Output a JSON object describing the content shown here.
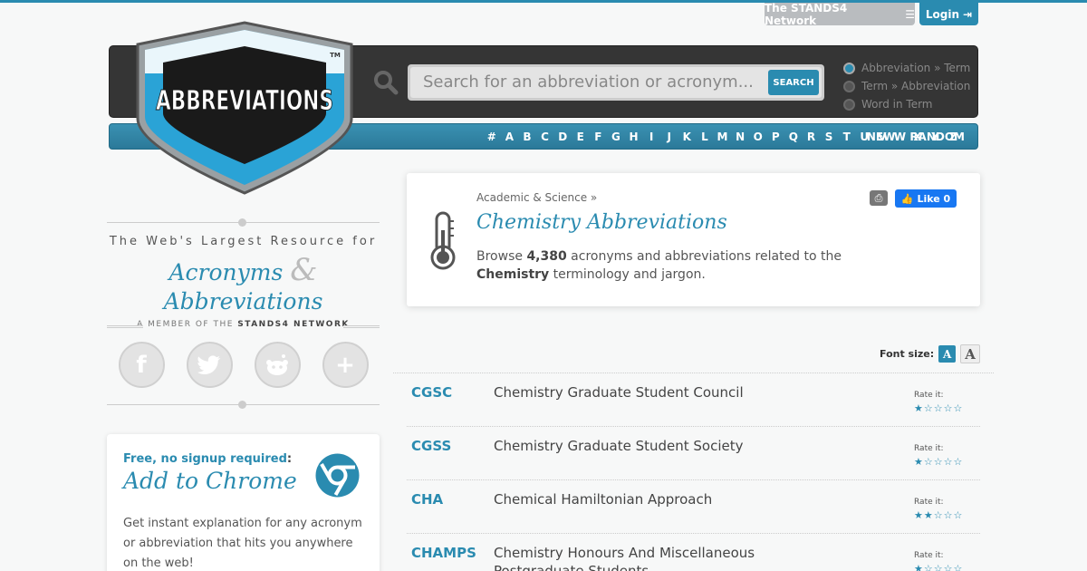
{
  "topbar": {
    "network_label": "The STANDS4 Network",
    "login_label": "Login"
  },
  "logo": {
    "text": "ABBREVIATIONS",
    "tm": "TM"
  },
  "search": {
    "placeholder": "Search for an abbreviation or acronym...",
    "button_label": "SEARCH"
  },
  "search_modes": [
    {
      "label": "Abbreviation » Term",
      "selected": true
    },
    {
      "label": "Term » Abbreviation",
      "selected": false
    },
    {
      "label": "Word in Term",
      "selected": false
    }
  ],
  "letter_nav": {
    "letters": [
      "#",
      "A",
      "B",
      "C",
      "D",
      "E",
      "F",
      "G",
      "H",
      "I",
      "J",
      "K",
      "L",
      "M",
      "N",
      "O",
      "P",
      "Q",
      "R",
      "S",
      "T",
      "U",
      "V",
      "W",
      "X",
      "Y",
      "Z"
    ],
    "new_label": "NEW",
    "random_label": "RANDOM"
  },
  "tagline": {
    "line1": "The Web's Largest Resource for",
    "acronyms": "Acronyms",
    "amp": "&",
    "abbreviations": "Abbreviations",
    "member_prefix": "A MEMBER OF THE ",
    "member_network": "STANDS4 NETWORK"
  },
  "socials": [
    {
      "icon": "facebook-icon",
      "glyph": "f"
    },
    {
      "icon": "twitter-icon",
      "glyph": "t"
    },
    {
      "icon": "reddit-icon",
      "glyph": "r"
    },
    {
      "icon": "plus-icon",
      "glyph": "+"
    }
  ],
  "chrome_box": {
    "free_label": "Free, no signup required",
    "colon": ":",
    "title": "Add to Chrome",
    "description": "Get instant explanation for any acronym or abbreviation that hits you anywhere on the web!"
  },
  "category": {
    "breadcrumb": "Academic & Science »",
    "title": "Chemistry Abbreviations",
    "desc_prefix": "Browse ",
    "count": "4,380",
    "desc_middle": " acronyms and abbreviations related to the ",
    "subject": "Chemistry",
    "desc_suffix": " terminology and jargon.",
    "like_label": "Like 0"
  },
  "font_size": {
    "label": "Font size:",
    "small": "A",
    "large": "A"
  },
  "results": [
    {
      "abbr": "CGSC",
      "term": "Chemistry Graduate Student Council",
      "rate_label": "Rate it:",
      "rating": 1
    },
    {
      "abbr": "CGSS",
      "term": "Chemistry Graduate Student Society",
      "rate_label": "Rate it:",
      "rating": 1
    },
    {
      "abbr": "CHA",
      "term": "Chemical Hamiltonian Approach",
      "rate_label": "Rate it:",
      "rating": 2
    },
    {
      "abbr": "CHAMPS",
      "term": "Chemistry Honours And Miscellaneous Postgraduate Students",
      "rate_label": "Rate it:",
      "rating": 1
    }
  ],
  "colors": {
    "accent": "#2a8bb0",
    "header_dark": "#353535",
    "background": "#f7f8f8"
  }
}
